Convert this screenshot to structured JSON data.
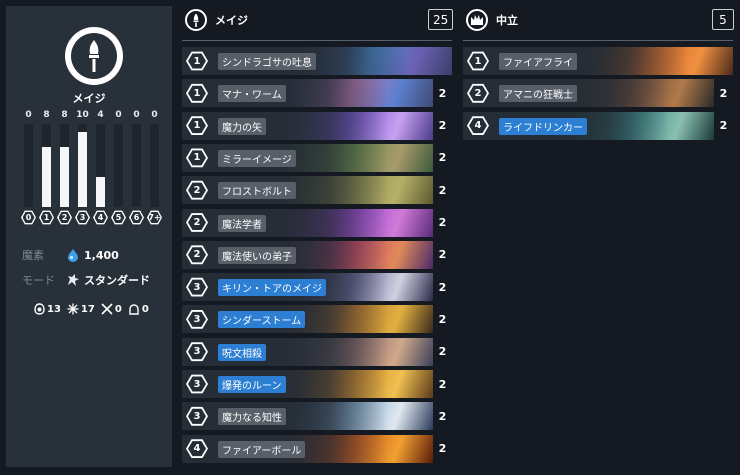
{
  "sidebar": {
    "class_name": "メイジ",
    "mana_curve": [
      {
        "label": "0",
        "count": "0",
        "value": 0
      },
      {
        "label": "1",
        "count": "8",
        "value": 8
      },
      {
        "label": "2",
        "count": "8",
        "value": 8
      },
      {
        "label": "3",
        "count": "10",
        "value": 10
      },
      {
        "label": "4",
        "count": "4",
        "value": 4
      },
      {
        "label": "5",
        "count": "0",
        "value": 0
      },
      {
        "label": "6",
        "count": "0",
        "value": 0
      },
      {
        "label": "7+",
        "count": "0",
        "value": 0
      }
    ],
    "dust_label": "魔素",
    "dust_value": "1,400",
    "mode_label": "モード",
    "mode_value": "スタンダード",
    "stats": [
      {
        "icon": "minion-icon",
        "value": "13"
      },
      {
        "icon": "spell-icon",
        "value": "17"
      },
      {
        "icon": "weapon-icon",
        "value": "0"
      },
      {
        "icon": "hero-icon",
        "value": "0"
      }
    ]
  },
  "mage_section": {
    "title": "メイジ",
    "count": "25",
    "cards": [
      {
        "cost": "1",
        "name": "シンドラゴサの吐息",
        "qty": "",
        "rarity": "legendary",
        "art": [
          "#3b3f6b",
          "#4a8fd6",
          "#6a5fb0"
        ]
      },
      {
        "cost": "1",
        "name": "マナ・ワーム",
        "qty": "2",
        "rarity": "common",
        "art": [
          "#3f4a72",
          "#c27bb7",
          "#5b7fd0"
        ]
      },
      {
        "cost": "1",
        "name": "魔力の矢",
        "qty": "2",
        "rarity": "common",
        "art": [
          "#4b3a8a",
          "#7b5ad6",
          "#c7a1f0"
        ]
      },
      {
        "cost": "1",
        "name": "ミラーイメージ",
        "qty": "2",
        "rarity": "common",
        "art": [
          "#3a5a3a",
          "#6b8f4a",
          "#a89a6b"
        ]
      },
      {
        "cost": "2",
        "name": "フロストボルト",
        "qty": "2",
        "rarity": "common",
        "art": [
          "#5b5a2e",
          "#8b8a4a",
          "#b7b06a"
        ]
      },
      {
        "cost": "2",
        "name": "魔法学者",
        "qty": "2",
        "rarity": "common",
        "art": [
          "#5a2a7a",
          "#9a4ad0",
          "#d07ad8"
        ]
      },
      {
        "cost": "2",
        "name": "魔法使いの弟子",
        "qty": "2",
        "rarity": "common",
        "art": [
          "#4a2a6a",
          "#d04a6a",
          "#e08a5a"
        ]
      },
      {
        "cost": "3",
        "name": "キリン・トアのメイジ",
        "qty": "2",
        "rarity": "rare",
        "art": [
          "#2a2a4a",
          "#6a6a9a",
          "#d0d0e0"
        ]
      },
      {
        "cost": "3",
        "name": "シンダーストーム",
        "qty": "2",
        "rarity": "rare",
        "art": [
          "#3a2a1a",
          "#c07a2a",
          "#e0b040"
        ]
      },
      {
        "cost": "3",
        "name": "呪文相殺",
        "qty": "2",
        "rarity": "rare",
        "art": [
          "#3a3f5a",
          "#8a6a6a",
          "#d0a88a"
        ]
      },
      {
        "cost": "3",
        "name": "爆発のルーン",
        "qty": "2",
        "rarity": "rare",
        "art": [
          "#5a3a1a",
          "#d08a2a",
          "#f0c050"
        ]
      },
      {
        "cost": "3",
        "name": "魔力なる知性",
        "qty": "2",
        "rarity": "common",
        "art": [
          "#2a3a5a",
          "#8ab0d0",
          "#e0e8f0"
        ]
      },
      {
        "cost": "4",
        "name": "ファイアーボール",
        "qty": "2",
        "rarity": "common",
        "art": [
          "#5a1a0a",
          "#d05a1a",
          "#f0a030"
        ]
      }
    ]
  },
  "neutral_section": {
    "title": "中立",
    "count": "5",
    "cards": [
      {
        "cost": "1",
        "name": "ファイアフライ",
        "qty": "",
        "rarity": "common",
        "art": [
          "#4a2a1a",
          "#d06a2a",
          "#f09040"
        ]
      },
      {
        "cost": "2",
        "name": "アマニの狂戦士",
        "qty": "2",
        "rarity": "common",
        "art": [
          "#2a2a2a",
          "#6a4a3a",
          "#b07a4a"
        ]
      },
      {
        "cost": "4",
        "name": "ライフドリンカー",
        "qty": "2",
        "rarity": "rare",
        "art": [
          "#1a3a3a",
          "#3a8a8a",
          "#8ac0b0"
        ]
      }
    ]
  }
}
